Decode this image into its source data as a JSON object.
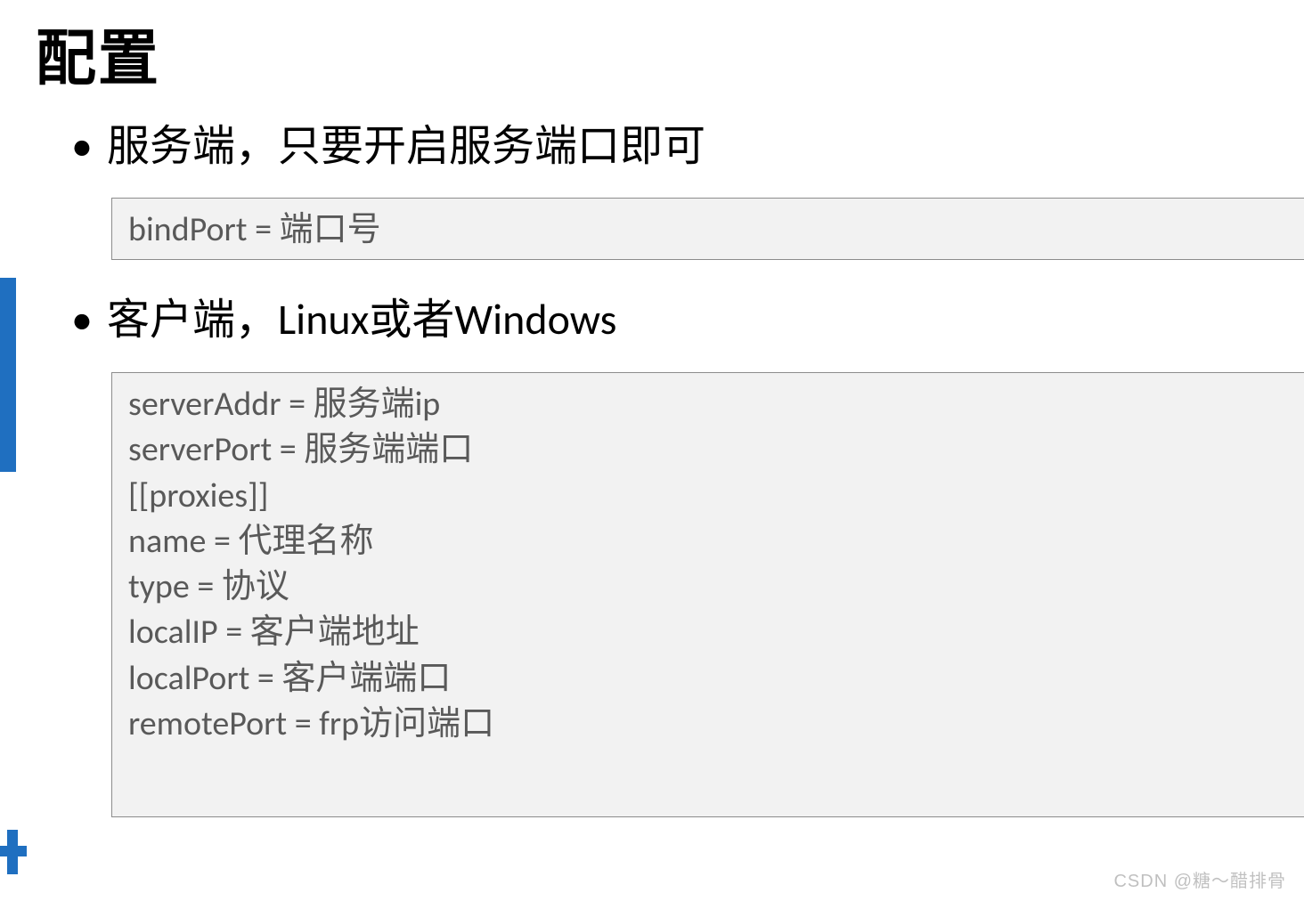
{
  "title": "配置",
  "bullets": [
    "服务端，只要开启服务端口即可",
    "客户端，Linux或者Windows"
  ],
  "server_config": {
    "lines": [
      "bindPort = 端口号"
    ]
  },
  "client_config": {
    "lines": [
      "serverAddr = 服务端ip",
      "serverPort = 服务端端口",
      "[[proxies]]",
      "name = 代理名称",
      "type = 协议",
      "localIP = 客户端地址",
      "localPort = 客户端端口",
      "remotePort = frp访问端口"
    ]
  },
  "watermark": "CSDN @糖～醋排骨",
  "accent_color": "#1f6fc0"
}
